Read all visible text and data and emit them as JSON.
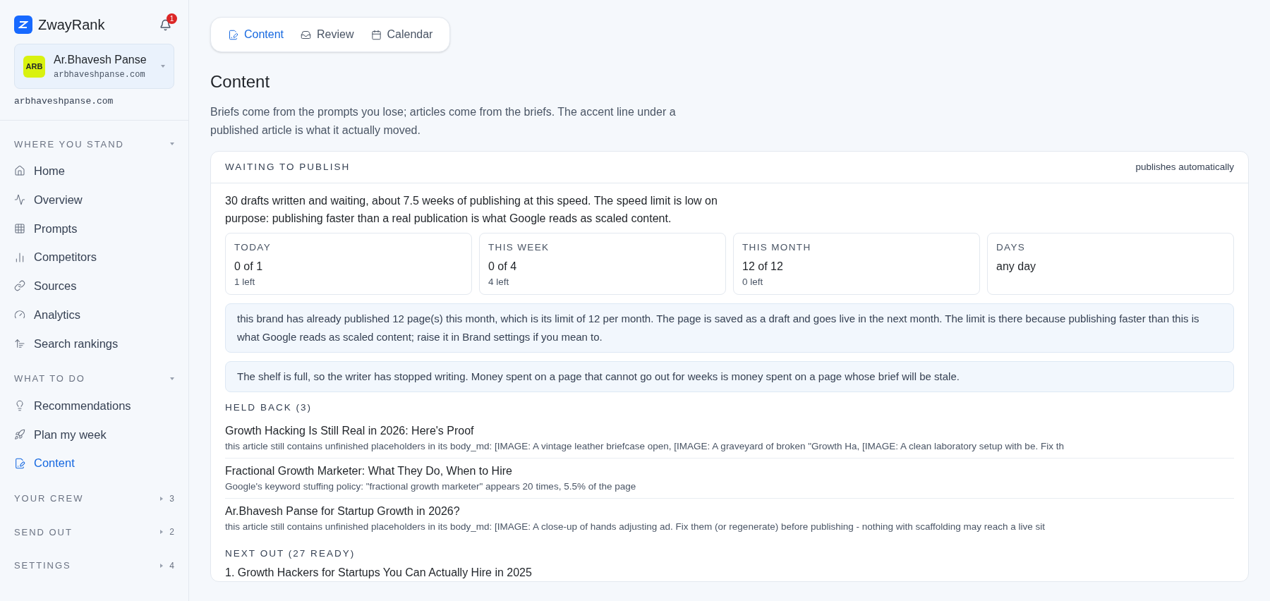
{
  "brand": {
    "name": "ZwayRank",
    "notifications": "1"
  },
  "account": {
    "initials": "ARB",
    "name": "Ar.Bhavesh Panse",
    "domain": "arbhaveshpanse.com",
    "site": "arbhaveshpanse.com"
  },
  "sidebar": {
    "groups": [
      {
        "title": "WHERE YOU STAND",
        "expanded": true,
        "items": [
          {
            "label": "Home",
            "selected": false
          },
          {
            "label": "Overview",
            "selected": false
          },
          {
            "label": "Prompts",
            "selected": false
          },
          {
            "label": "Competitors",
            "selected": false
          },
          {
            "label": "Sources",
            "selected": false
          },
          {
            "label": "Analytics",
            "selected": false
          },
          {
            "label": "Search rankings",
            "selected": false
          }
        ]
      },
      {
        "title": "WHAT TO DO",
        "expanded": true,
        "items": [
          {
            "label": "Recommendations",
            "selected": false
          },
          {
            "label": "Plan my week",
            "selected": false
          },
          {
            "label": "Content",
            "selected": true
          }
        ]
      },
      {
        "title": "YOUR CREW",
        "expanded": false,
        "count": "3"
      },
      {
        "title": "SEND OUT",
        "expanded": false,
        "count": "2"
      },
      {
        "title": "SETTINGS",
        "expanded": false,
        "count": "4"
      }
    ]
  },
  "tabs": [
    {
      "label": "Content",
      "selected": true
    },
    {
      "label": "Review",
      "selected": false
    },
    {
      "label": "Calendar",
      "selected": false
    }
  ],
  "page": {
    "title": "Content",
    "intro": "Briefs come from the prompts you lose; articles come from the briefs. The accent line under a published article is what it actually moved."
  },
  "card": {
    "title": "WAITING TO PUBLISH",
    "note": "publishes automatically",
    "summary": "30 drafts written and waiting, about 7.5 weeks of publishing at this speed. The speed limit is low on purpose: publishing faster than a real publication is what Google reads as scaled content.",
    "stats": [
      {
        "label": "TODAY",
        "value": "0 of 1",
        "sub": "1 left"
      },
      {
        "label": "THIS WEEK",
        "value": "0 of 4",
        "sub": "4 left"
      },
      {
        "label": "THIS MONTH",
        "value": "12 of 12",
        "sub": "0 left"
      },
      {
        "label": "DAYS",
        "value": "any day"
      }
    ],
    "notices": [
      "this brand has already published 12 page(s) this month, which is its limit of 12 per month. The page is saved as a draft and goes live in the next month. The limit is there because publishing faster than this is what Google reads as scaled content; raise it in Brand settings if you mean to.",
      "The shelf is full, so the writer has stopped writing. Money spent on a page that cannot go out for weeks is money spent on a page whose brief will be stale."
    ],
    "held_back": {
      "title": "HELD BACK (3)",
      "items": [
        {
          "title": "Growth Hacking Is Still Real in 2026: Here's Proof",
          "reason": "this article still contains unfinished placeholders in its body_md: [IMAGE: A vintage leather briefcase open, [IMAGE: A graveyard of broken \"Growth Ha, [IMAGE: A clean laboratory setup with be. Fix th"
        },
        {
          "title": "Fractional Growth Marketer: What They Do, When to Hire",
          "reason": "Google's keyword stuffing policy: \"fractional growth marketer\" appears 20 times, 5.5% of the page"
        },
        {
          "title": "Ar.Bhavesh Panse for Startup Growth in 2026?",
          "reason": "this article still contains unfinished placeholders in its body_md: [IMAGE: A close-up of hands adjusting ad. Fix them (or regenerate) before publishing - nothing with scaffolding may reach a live sit"
        }
      ]
    },
    "next_out": {
      "title": "NEXT OUT (27 READY)",
      "items": [
        "1. Growth Hackers for Startups You Can Actually Hire in 2025"
      ]
    }
  }
}
